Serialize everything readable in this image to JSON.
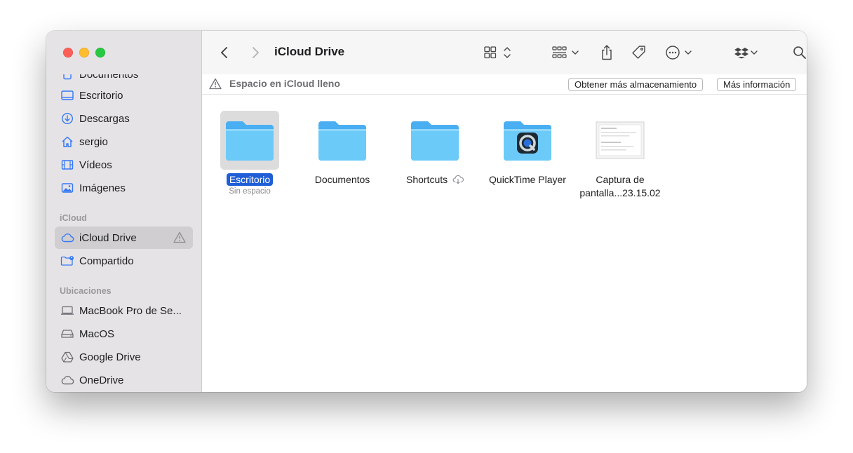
{
  "window": {
    "title": "iCloud Drive"
  },
  "sidebar": {
    "partial_item": "Documentos",
    "favorites": [
      {
        "label": "Escritorio",
        "icon": "desktop-icon"
      },
      {
        "label": "Descargas",
        "icon": "download-icon"
      },
      {
        "label": "sergio",
        "icon": "home-icon"
      },
      {
        "label": "Vídeos",
        "icon": "film-icon"
      },
      {
        "label": "Imágenes",
        "icon": "photo-icon"
      }
    ],
    "icloud_header": "iCloud",
    "icloud": [
      {
        "label": "iCloud Drive",
        "icon": "cloud-icon",
        "active": true
      },
      {
        "label": "Compartido",
        "icon": "shared-folder-icon"
      }
    ],
    "locations_header": "Ubicaciones",
    "locations": [
      {
        "label": "MacBook Pro de Se...",
        "icon": "laptop-icon"
      },
      {
        "label": "MacOS",
        "icon": "disk-icon"
      },
      {
        "label": "Google Drive",
        "icon": "google-drive-icon"
      },
      {
        "label": "OneDrive",
        "icon": "cloud-icon"
      }
    ]
  },
  "banner": {
    "message": "Espacio en iCloud lleno",
    "get_storage": "Obtener más almacenamiento",
    "more_info": "Más información"
  },
  "files": [
    {
      "name": "Escritorio",
      "sub": "Sin espacio",
      "type": "folder",
      "selected": true
    },
    {
      "name": "Documentos",
      "type": "folder"
    },
    {
      "name": "Shortcuts",
      "type": "folder",
      "cloud": true
    },
    {
      "name": "QuickTime Player",
      "type": "app"
    },
    {
      "name_line1": "Captura de",
      "name_line2": "pantalla...23.15.02",
      "type": "screenshot"
    }
  ],
  "colors": {
    "accent": "#1f5ed6",
    "folder": "#5bc0f8",
    "close": "#fe5f57",
    "minimize": "#febc2e",
    "maximize": "#28c840"
  }
}
